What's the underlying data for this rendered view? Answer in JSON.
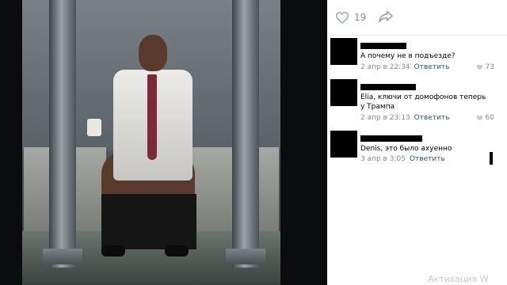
{
  "post": {
    "likes": "19",
    "icons": {
      "like": "heart-icon",
      "share": "share-arrow-icon"
    }
  },
  "comments": [
    {
      "text": "А почему не в подъезде?",
      "date": "2 апр в 22:34",
      "reply": "Ответить",
      "likes": "73"
    },
    {
      "text": "Elia, ключи от домофонов теперь у Трампа",
      "date": "2 апр в 23:13",
      "reply": "Ответить",
      "likes": "60"
    },
    {
      "text": "Denis, это было ахуенно",
      "date": "3 апр в 3:05",
      "reply": "Ответить",
      "likes": ""
    }
  ],
  "watermark": "Активация W",
  "colors": {
    "link": "#2a5885",
    "meta": "#828a99"
  }
}
